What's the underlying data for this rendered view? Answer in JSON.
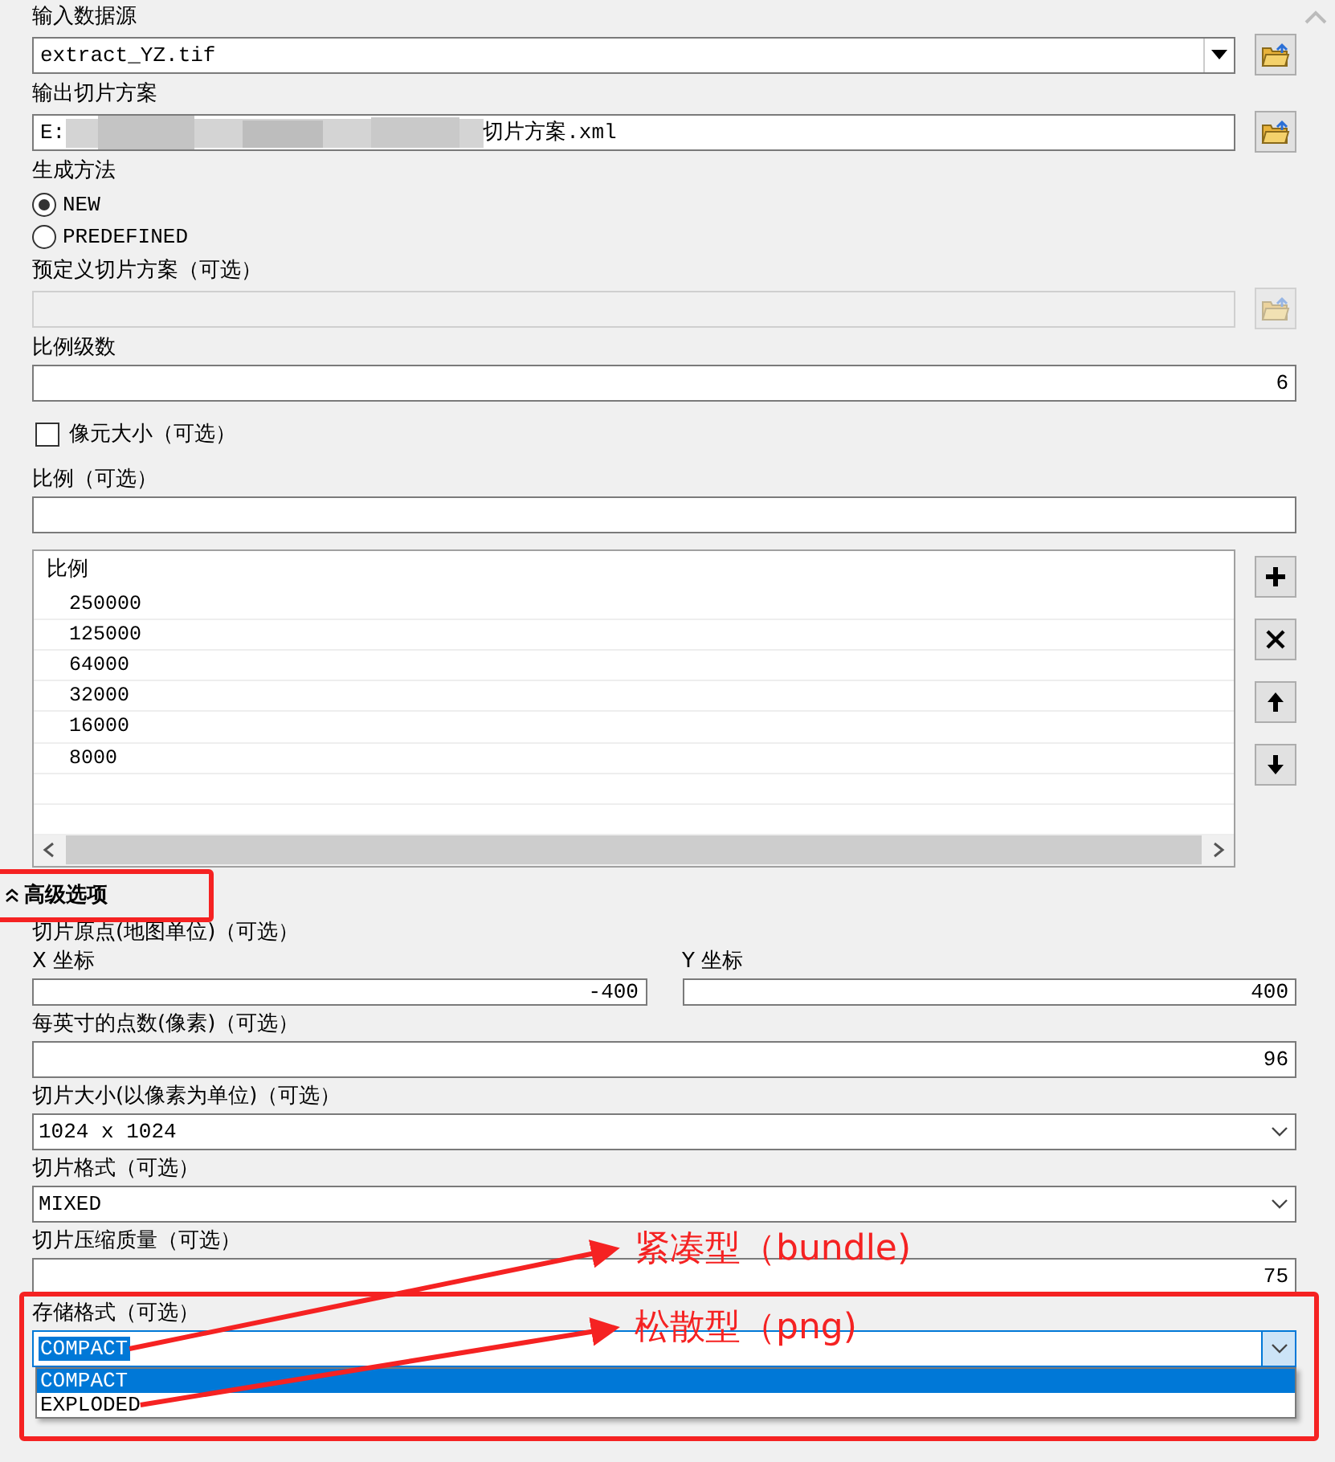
{
  "parameters": [
    {
      "kind": "combobox",
      "label": "输入数据源",
      "value": "extract_YZ.tif",
      "browse": true
    },
    {
      "kind": "path",
      "label": "输出切片方案",
      "value_parts": [
        "E:",
        "切片方案.xml"
      ],
      "browse": true
    },
    {
      "kind": "radio",
      "label": "生成方法",
      "options": [
        {
          "label": "NEW",
          "selected": true
        },
        {
          "label": "PREDEFINED",
          "selected": false
        }
      ]
    },
    {
      "kind": "text",
      "label": "预定义切片方案（可选）",
      "disabled": true,
      "browse": true
    },
    {
      "kind": "text",
      "label": "比例级数",
      "value": "6"
    },
    {
      "kind": "checkbox",
      "label": "像元大小（可选）",
      "checked": false
    },
    {
      "kind": "text",
      "label": "比例（可选）"
    },
    {
      "kind": "table",
      "column": "比例",
      "rows": [
        "250000",
        "125000",
        "64000",
        "32000",
        "16000",
        "8000"
      ]
    },
    {
      "kind": "section",
      "label": "高级选项",
      "expanded": true,
      "highlighted": true
    },
    {
      "kind": "label",
      "label": "切片原点(地图单位)（可选）"
    },
    {
      "kind": "pair",
      "items": [
        {
          "label": "X 坐标",
          "value": "-400"
        },
        {
          "label": "Y 坐标",
          "value": "400"
        }
      ]
    },
    {
      "kind": "text",
      "label": "每英寸的点数(像素)（可选）",
      "value": "96"
    },
    {
      "kind": "dropdown",
      "label": "切片大小(以像素为单位)（可选）",
      "value": "1024 x 1024"
    },
    {
      "kind": "dropdown",
      "label": "切片格式（可选）",
      "value": "MIXED"
    },
    {
      "kind": "text",
      "label": "切片压缩质量（可选）",
      "value": "75"
    },
    {
      "kind": "dropdown",
      "label": "存储格式（可选）",
      "value": "COMPACT",
      "open": true,
      "highlighted": true,
      "options": [
        {
          "label": "COMPACT",
          "selected": true
        },
        {
          "label": "EXPLODED",
          "selected": false
        }
      ]
    }
  ],
  "annotations": [
    {
      "text": "紧凑型（bundle)"
    },
    {
      "text": "松散型（png)"
    }
  ]
}
